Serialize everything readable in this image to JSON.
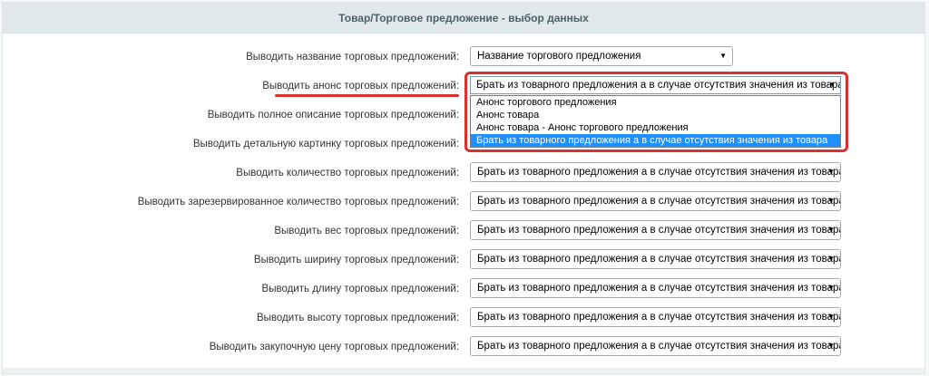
{
  "panel": {
    "title": "Товар/Торговое предложение - выбор данных"
  },
  "form": {
    "rows": [
      {
        "label": "Выводить название торговых предложений:",
        "value": "Название торгового предложения"
      },
      {
        "label": "Выводить анонс торговых предложений:",
        "value": "Брать из товарного предложения а в случае отсутствия значения из товара"
      },
      {
        "label": "Выводить полное описание торговых предложений:",
        "value": ""
      },
      {
        "label": "Выводить детальную картинку торговых предложений:",
        "value": ""
      },
      {
        "label": "Выводить количество торговых предложений:",
        "value": "Брать из товарного предложения а в случае отсутствия значения из товара"
      },
      {
        "label": "Выводить зарезервированное количество торговых предложений:",
        "value": "Брать из товарного предложения а в случае отсутствия значения из товара"
      },
      {
        "label": "Выводить вес торговых предложений:",
        "value": "Брать из товарного предложения а в случае отсутствия значения из товара"
      },
      {
        "label": "Выводить ширину торговых предложений:",
        "value": "Брать из товарного предложения а в случае отсутствия значения из товара"
      },
      {
        "label": "Выводить длину торговых предложений:",
        "value": "Брать из товарного предложения а в случае отсутствия значения из товара"
      },
      {
        "label": "Выводить высоту торговых предложений:",
        "value": "Брать из товарного предложения а в случае отсутствия значения из товара"
      },
      {
        "label": "Выводить закупочную цену торговых предложений:",
        "value": "Брать из товарного предложения а в случае отсутствия значения из товара"
      }
    ]
  },
  "dropdown": {
    "options": [
      "Анонс торгового предложения",
      "Анонс товара",
      "Анонс товара - Анонс торгового предложения",
      "Брать из товарного предложения а в случае отсутствия значения из товара"
    ],
    "selected_index": 3
  },
  "icons": {
    "select_arrow": "caret-down-icon",
    "arrow_glyph": "▼"
  },
  "colors": {
    "header_bg": "#e0e8ea",
    "highlight": "#d9312e",
    "option_selected": "#1e90ff"
  }
}
